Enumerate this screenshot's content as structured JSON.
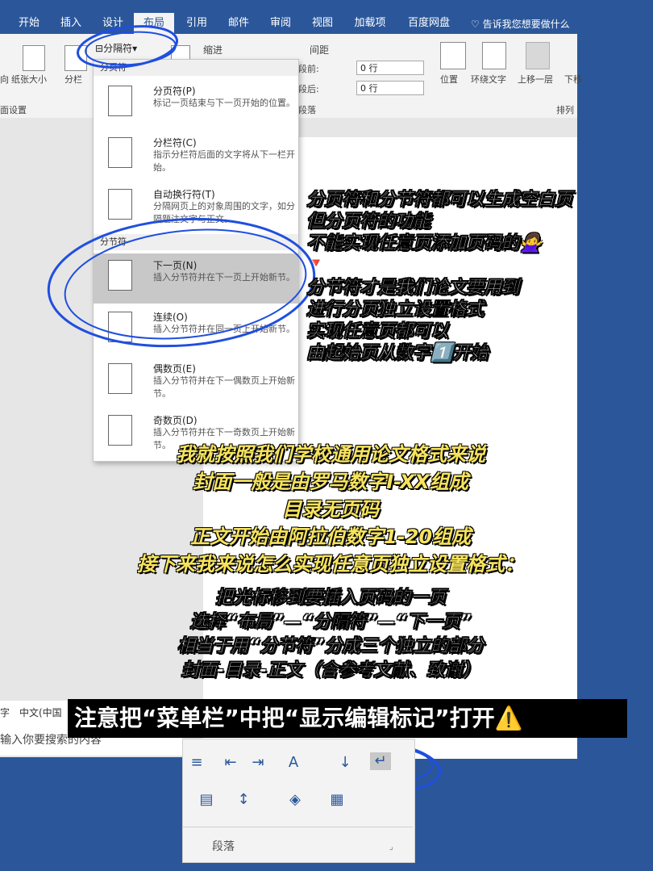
{
  "ribbon": {
    "tabs": [
      "开始",
      "插入",
      "设计",
      "布局",
      "引用",
      "邮件",
      "审阅",
      "视图",
      "加载项",
      "百度网盘"
    ],
    "active_tab": "布局",
    "tell_me": "告诉我您想要做什么",
    "breaks_button": "分隔符",
    "indent_label": "缩进",
    "spacing_label": "间距",
    "spacing_before_label": "段前:",
    "spacing_before_value": "0 行",
    "spacing_after_label": "段后:",
    "spacing_after_value": "0 行",
    "left_buttons": [
      "向",
      "纸张大小",
      "分栏"
    ],
    "page_setup_group": "面设置",
    "paragraph_group": "段落",
    "arrange_group": "排列",
    "arrange_buttons": [
      "位置",
      "环绕文字",
      "上移一层",
      "下移"
    ]
  },
  "menu": {
    "page_section": "分页符",
    "section_section": "分节符",
    "page_items": [
      {
        "title": "分页符(P)",
        "desc": "标记一页结束与下一页开始的位置。"
      },
      {
        "title": "分栏符(C)",
        "desc": "指示分栏符后面的文字将从下一栏开始。"
      },
      {
        "title": "自动换行符(T)",
        "desc": "分隔网页上的对象周围的文字，如分隔题注文字与正文。"
      }
    ],
    "section_items": [
      {
        "title": "下一页(N)",
        "desc": "插入分节符并在下一页上开始新节。"
      },
      {
        "title": "连续(O)",
        "desc": "插入分节符并在同一页上开始新节。"
      },
      {
        "title": "偶数页(E)",
        "desc": "插入分节符并在下一偶数页上开始新节。"
      },
      {
        "title": "奇数页(D)",
        "desc": "插入分节符并在下一奇数页上开始新节。"
      }
    ]
  },
  "captions": {
    "right_block_1": [
      "分页符和分节符都可以生成空白页",
      "但分页符的功能",
      "不能实现任意页添加页码的🙅‍♀️"
    ],
    "marker": "🔻",
    "right_block_2": [
      "分节符才是我们论文要用到",
      "进行分页独立设置格式",
      "实现任意页都可以",
      "由起始页从数字1️⃣开始"
    ],
    "center_yellow": [
      "我就按照我们学校通用论文格式来说",
      "封面一般是由罗马数字I-XX组成",
      "目录无页码",
      "正文开始由阿拉伯数字1-20组成",
      "接下来我来说怎么实现任意页独立设置格式："
    ],
    "center_white": [
      "把光标移到要插入页码的一页",
      "选择“布局”—“分隔符”—“下一页”",
      "相当于用“分节符”分成三个独立的部分",
      "封面-目录-正文（含参考文献、致谢）"
    ],
    "black_bar": "注意把“菜单栏”中把“显示编辑标记”打开⚠️"
  },
  "status": {
    "lang": "中文(中国",
    "prefix": "字",
    "search_placeholder": "输入你要搜索的内容"
  },
  "bottom_panel": {
    "group_label": "段落"
  }
}
